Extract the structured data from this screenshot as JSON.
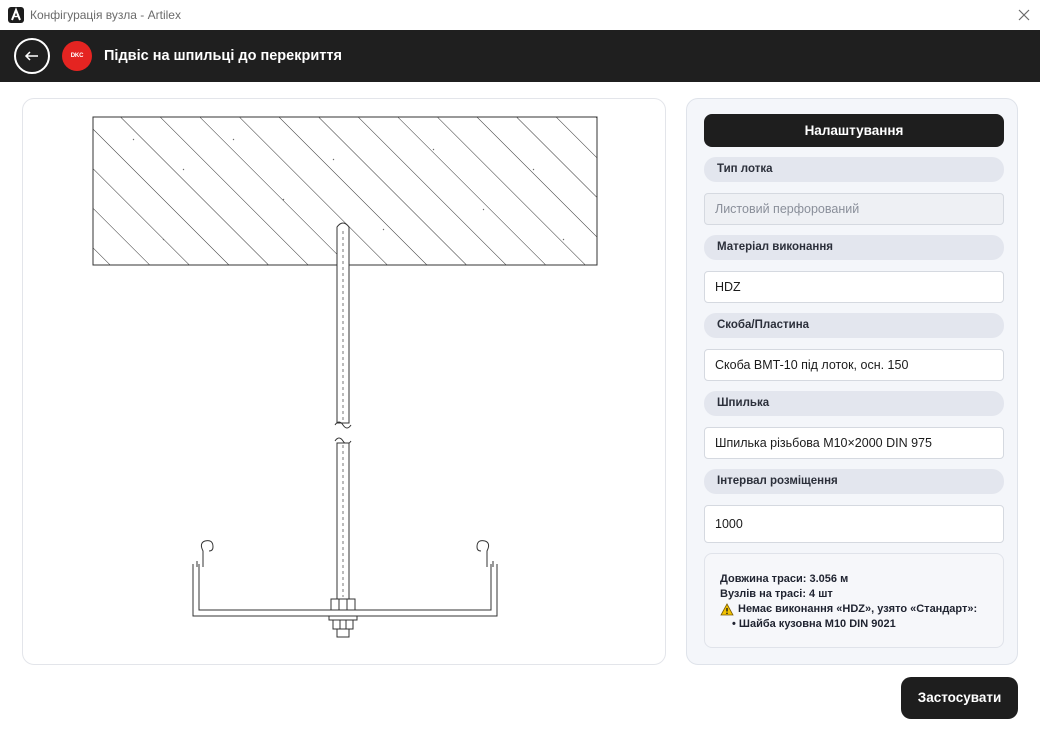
{
  "window": {
    "title": "Конфігурація вузла - Artilex"
  },
  "header": {
    "brand": "DKC",
    "title": "Підвіс на шпильці до перекриття"
  },
  "settings": {
    "button_label": "Налаштування",
    "fields": [
      {
        "label": "Тип лотка",
        "value": "Листовий перфорований",
        "disabled": true
      },
      {
        "label": "Матеріал виконання",
        "value": "HDZ"
      },
      {
        "label": "Скоба/Пластина",
        "value": "Скоба BMT-10 під лоток, осн. 150"
      },
      {
        "label": "Шпилька",
        "value": "Шпилька різьбова M10×2000 DIN 975"
      },
      {
        "label": "Інтервал розміщення",
        "value": "1000"
      }
    ],
    "info": {
      "length": "Довжина траси: 3.056 м",
      "nodes": "Вузлів на трасі: 4 шт",
      "warning": "Немає виконання «HDZ», узято «Стандарт»:",
      "bullet": "• Шайба кузовна M10 DIN 9021"
    }
  },
  "actions": {
    "apply_label": "Застосувати"
  },
  "colors": {
    "header_bg": "#1f1f1f",
    "brand_red": "#e52421",
    "warning_yellow": "#f2c200"
  }
}
